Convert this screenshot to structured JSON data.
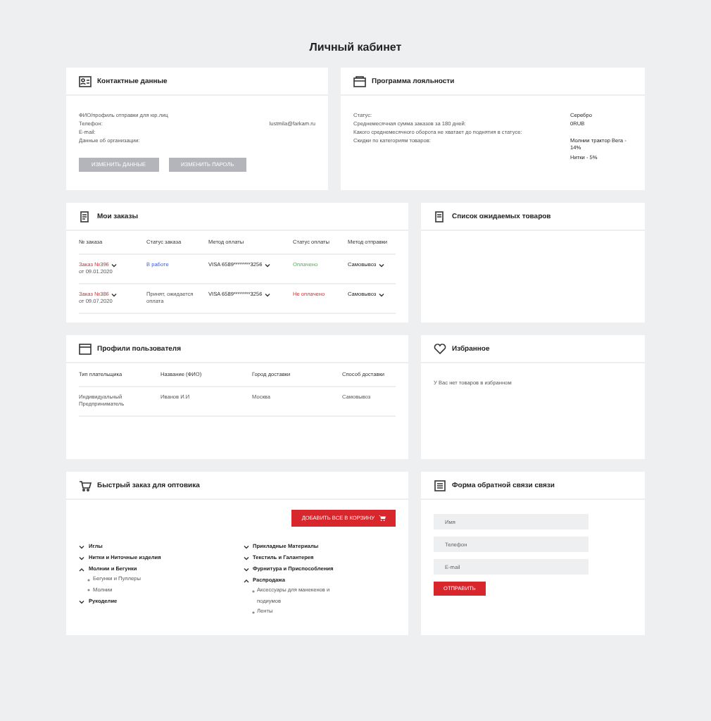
{
  "page_title": "Личный кабинет",
  "contacts": {
    "title": "Контактные данные",
    "rows": [
      {
        "label": "ФИО/профиль отправки для юр.лиц"
      },
      {
        "label": "Телефон:",
        "value": "lustmila@farkam.ru"
      },
      {
        "label": "E-mail:"
      },
      {
        "label": "Данные об организации:"
      }
    ],
    "buttons": [
      "ИЗМЕНИТЬ ДАННЫЕ",
      "ИЗМЕНИТЬ ПАРОЛЬ"
    ]
  },
  "loyalty": {
    "title": "Программа лояльности",
    "rows": [
      {
        "label": "Статус:",
        "values": [
          "Серебро"
        ]
      },
      {
        "label": "Среднемесячная сумма заказов за 180 дней:",
        "values": [
          "0RUB"
        ]
      },
      {
        "label": "Какого среднемесячного оборота не хватает до поднятия в статусе:",
        "values": []
      },
      {
        "label": "Скидки по категориям товаров:",
        "values": [
          "Молнии трактор Вега - 14%",
          "Нитки - 5%"
        ]
      }
    ]
  },
  "orders": {
    "title": "Мои заказы",
    "columns": [
      "№ заказа",
      "Статус заказа",
      "Метод оплаты",
      "Статус оплаты",
      "Метод отправки"
    ],
    "rows": [
      {
        "order": "Заказ №396",
        "date": "от 09.01.2020",
        "status": "В работе",
        "kind": "active",
        "payment": "VISA 6589********3256",
        "payment_status": "Оплачено",
        "paid": true,
        "shipping": "Самовывоз"
      },
      {
        "order": "Заказ №386",
        "date": "от 09.07.2020",
        "status": "Принят, ожидается оплата",
        "kind": "plain",
        "payment": "VISA 6589********3256",
        "payment_status": "Не оплачено",
        "paid": false,
        "shipping": "Самовывоз"
      }
    ]
  },
  "wishlist": {
    "title": "Список ожидаемых товаров"
  },
  "profile": {
    "title": "Профили пользователя",
    "columns": [
      "Тип плательщика",
      "Название (ФИО)",
      "Город доставки",
      "Способ доставки"
    ],
    "rows": [
      [
        "Индивидуальный Предприниматель",
        "Иванов И.И",
        "Москва",
        "Самовывоз"
      ]
    ]
  },
  "favorites": {
    "title": "Избранное",
    "empty_text": "У Вас нет товаров в избранном"
  },
  "quick_order": {
    "title": "Быстрый заказ для оптовика",
    "add_button": "ДОБАВИТЬ ВСЕ В КОРЗИНУ",
    "columns": [
      [
        {
          "label": "Иглы",
          "expanded": false
        },
        {
          "label": "Нитки и Ниточные изделия",
          "expanded": false
        },
        {
          "label": "Молнии и Бегунки",
          "expanded": true,
          "children": [
            {
              "label": "Бегунки и Пуллеры"
            },
            {
              "label": "Молнии"
            }
          ]
        },
        {
          "label": "Рукоделие",
          "expanded": false
        }
      ],
      [
        {
          "label": "Прикладные Материалы",
          "expanded": false
        },
        {
          "label": "Текстиль и Галантерея",
          "expanded": false
        },
        {
          "label": "Фурнитура и Приспособления",
          "expanded": false
        },
        {
          "label": "Распродажа",
          "expanded": true,
          "children": [
            {
              "label": "Аксессуары для манекенов и подиумов"
            },
            {
              "label": "Ленты"
            }
          ]
        }
      ]
    ]
  },
  "feedback": {
    "title": "Форма обратной связи связи",
    "fields": [
      {
        "placeholder": "Имя"
      },
      {
        "placeholder": "Телефон"
      },
      {
        "placeholder": "E-mail"
      }
    ],
    "submit": "ОТПРАВИТЬ"
  }
}
